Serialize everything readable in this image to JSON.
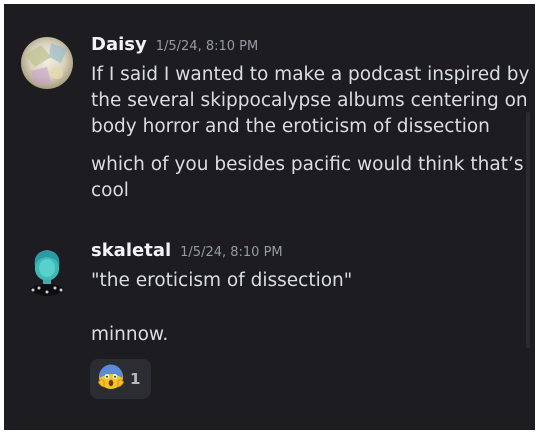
{
  "messages": [
    {
      "author": "Daisy",
      "timestamp": "1/5/24, 8:10 PM",
      "lines": [
        "If I said I wanted to make a podcast inspired by\nthe several skippocalypse albums centering on\nbody horror and the eroticism of dissection",
        "which of you besides pacific would think that’s\ncool"
      ]
    },
    {
      "author": "skaletal",
      "timestamp": "1/5/24, 8:10 PM",
      "lines": [
        "\"the eroticism of dissection\"",
        "minnow."
      ],
      "reactions": [
        {
          "emoji": "face-screaming-in-fear-icon",
          "count": "1"
        }
      ]
    }
  ],
  "colors": {
    "background": "#1c1c21",
    "username": "#f2f3f5",
    "timestamp": "#949ba4",
    "text": "#dbdee1",
    "reaction_bg": "#2b2d33"
  }
}
